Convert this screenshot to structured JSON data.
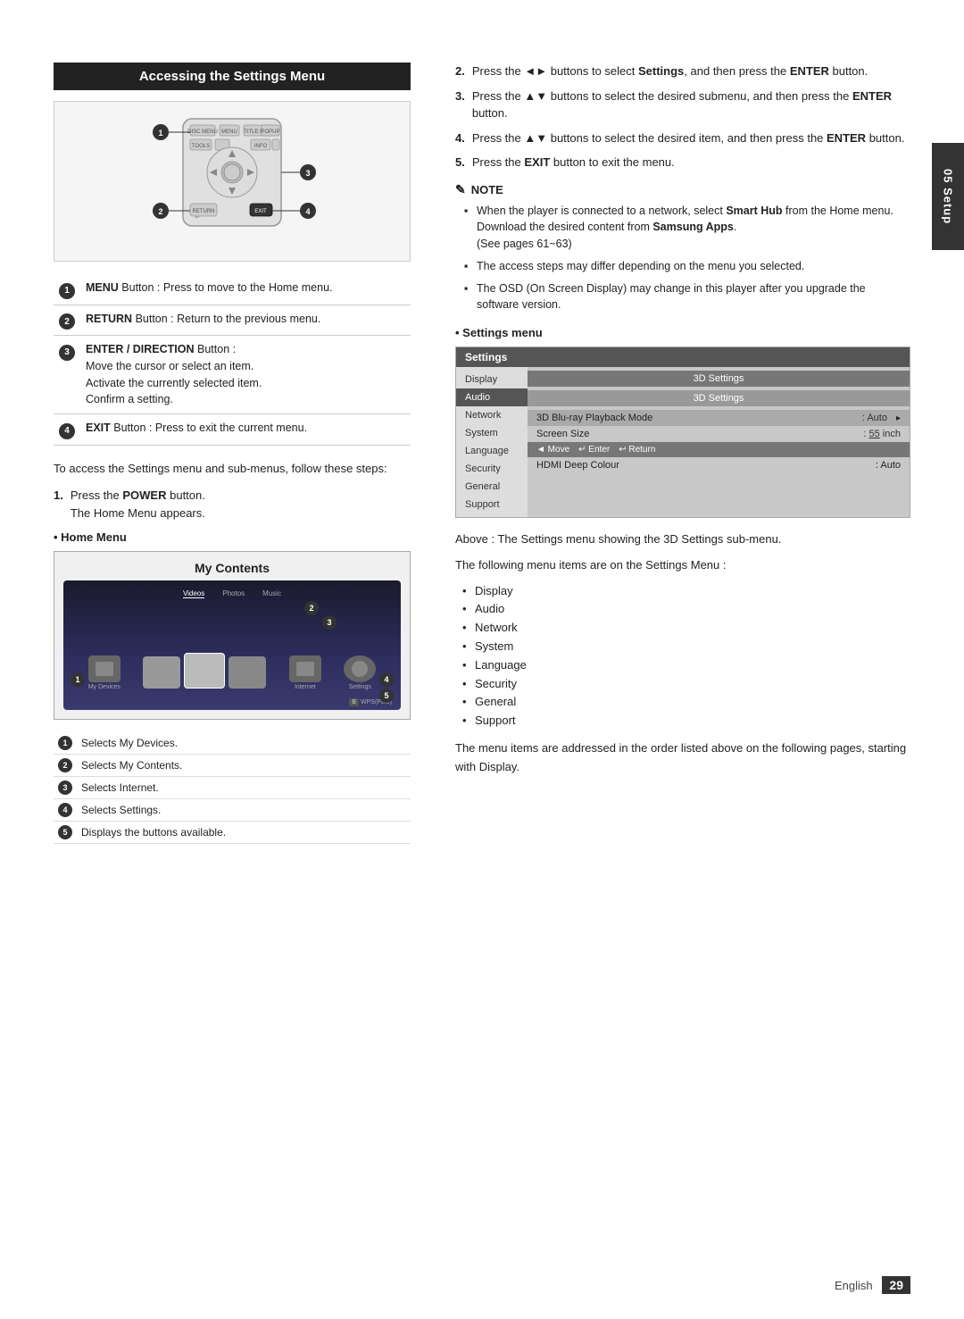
{
  "page": {
    "side_tab": "05 Setup",
    "footer_text": "English",
    "footer_num": "29"
  },
  "left": {
    "section_heading": "Accessing the Settings Menu",
    "button_legend": [
      {
        "num": "1",
        "label": "MENU Button : Press to move to the Home menu."
      },
      {
        "num": "2",
        "label": "RETURN Button : Return to the previous menu."
      },
      {
        "num": "3",
        "title": "ENTER / DIRECTION Button :",
        "lines": [
          "Move the cursor or select an item.",
          "Activate the currently selected item.",
          "Confirm a setting."
        ]
      },
      {
        "num": "4",
        "label": "EXIT Button : Press to exit the current menu."
      }
    ],
    "intro_text": "To access the Settings menu and sub-menus, follow these steps:",
    "step1_label": "1.",
    "step1_text": "Press the POWER button.\nThe Home Menu appears.",
    "step1_bold": "POWER",
    "home_menu_label": "• Home Menu",
    "home_menu_title": "My Contents",
    "home_menu_labels": [
      "Videos",
      "Photos",
      "Music"
    ],
    "home_menu_items": [
      "My Devices",
      "Internet",
      "Settings"
    ],
    "wps_label": "WPS(PBC)",
    "home_legend": [
      {
        "num": "1",
        "text": "Selects My Devices."
      },
      {
        "num": "2",
        "text": "Selects My Contents."
      },
      {
        "num": "3",
        "text": "Selects Internet."
      },
      {
        "num": "4",
        "text": "Selects Settings."
      },
      {
        "num": "5",
        "text": "Displays the buttons available."
      }
    ]
  },
  "right": {
    "steps": [
      {
        "num": "2.",
        "text": "Press the ◄► buttons to select Settings, and then press the ENTER button.",
        "bold_words": [
          "Settings",
          "ENTER"
        ]
      },
      {
        "num": "3.",
        "text": "Press the ▲▼ buttons to select the desired submenu, and then press the ENTER button.",
        "bold_words": [
          "ENTER"
        ]
      },
      {
        "num": "4.",
        "text": "Press the ▲▼ buttons to select the desired item, and then press the ENTER button.",
        "bold_words": [
          "ENTER"
        ]
      },
      {
        "num": "5.",
        "text": "Press the EXIT button to exit the menu.",
        "bold_words": [
          "EXIT"
        ]
      }
    ],
    "note_heading": "NOTE",
    "note_items": [
      "When the player is connected to a network, select Smart Hub from the Home menu. Download the desired content from Samsung Apps. (See pages 61~63)",
      "The access steps may differ depending on the menu you selected.",
      "The OSD (On Screen Display) may change in this player after you upgrade the software version."
    ],
    "settings_bullet": "• Settings menu",
    "settings_menu": {
      "title": "Settings",
      "items": [
        "Display",
        "Audio",
        "Network",
        "System",
        "Language",
        "Security",
        "General",
        "Support"
      ],
      "active": "Audio",
      "submenu_title": "3D Settings",
      "submenu_inner_title": "3D Settings",
      "submenu_rows": [
        {
          "label": "3D Blu-ray Playback Mode",
          "value": ": Auto",
          "highlighted": true
        },
        {
          "label": "Screen Size",
          "value": ": 55  inch",
          "highlighted": false
        }
      ],
      "nav_bar": "◄ Move  ↵ Enter  ↩ Return",
      "hdmi_row": {
        "label": "HDMI Deep Colour",
        "value": ": Auto"
      }
    },
    "above_text": "Above : The Settings menu showing the 3D Settings sub-menu.",
    "following_text": "The following menu items are on the Settings Menu :",
    "menu_items": [
      "Display",
      "Audio",
      "Network",
      "System",
      "Language",
      "Security",
      "General",
      "Support"
    ],
    "closing_text": "The menu items are addressed in the order listed above on the following pages, starting with Display."
  }
}
